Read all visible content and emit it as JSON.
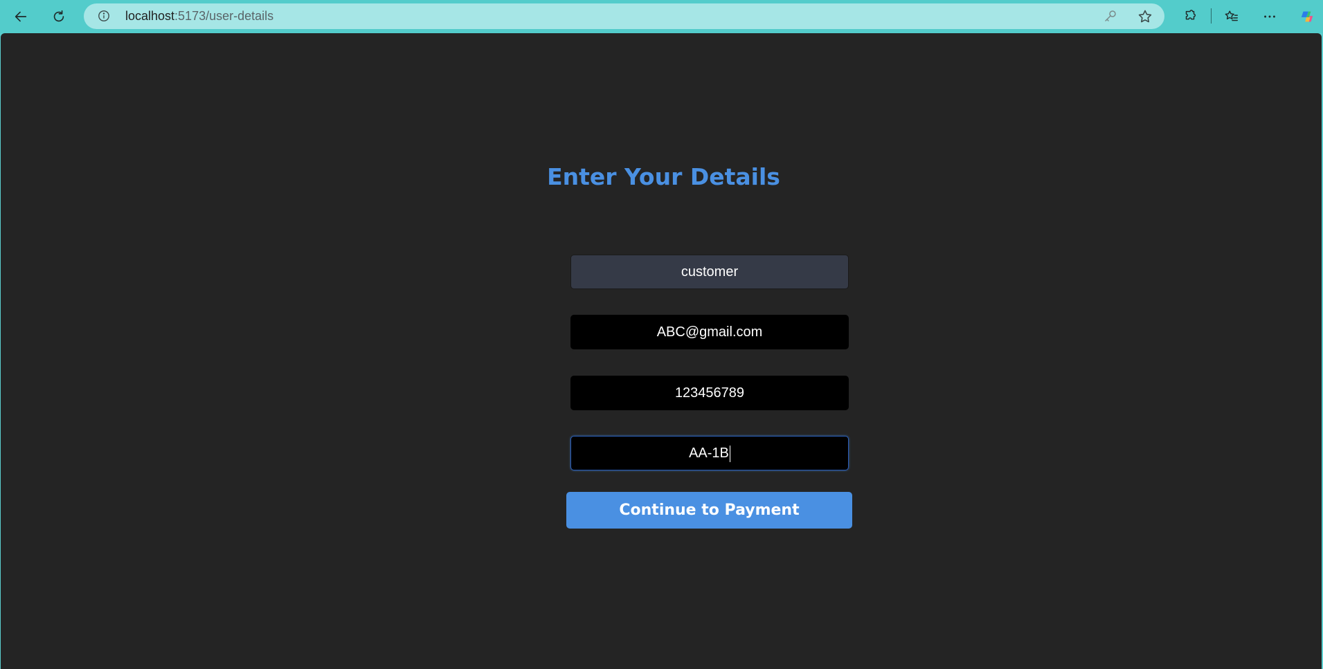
{
  "browser": {
    "url_host": "localhost",
    "url_path": ":5173/user-details"
  },
  "form": {
    "title": "Enter Your Details",
    "name_value": "customer",
    "email_value": "ABC@gmail.com",
    "phone_value": "123456789",
    "seat_value": "AA-1B",
    "submit_label": "Continue to Payment"
  },
  "colors": {
    "accent": "#4a90e2",
    "page_background": "#242424",
    "toolbar": "#53cccb"
  }
}
